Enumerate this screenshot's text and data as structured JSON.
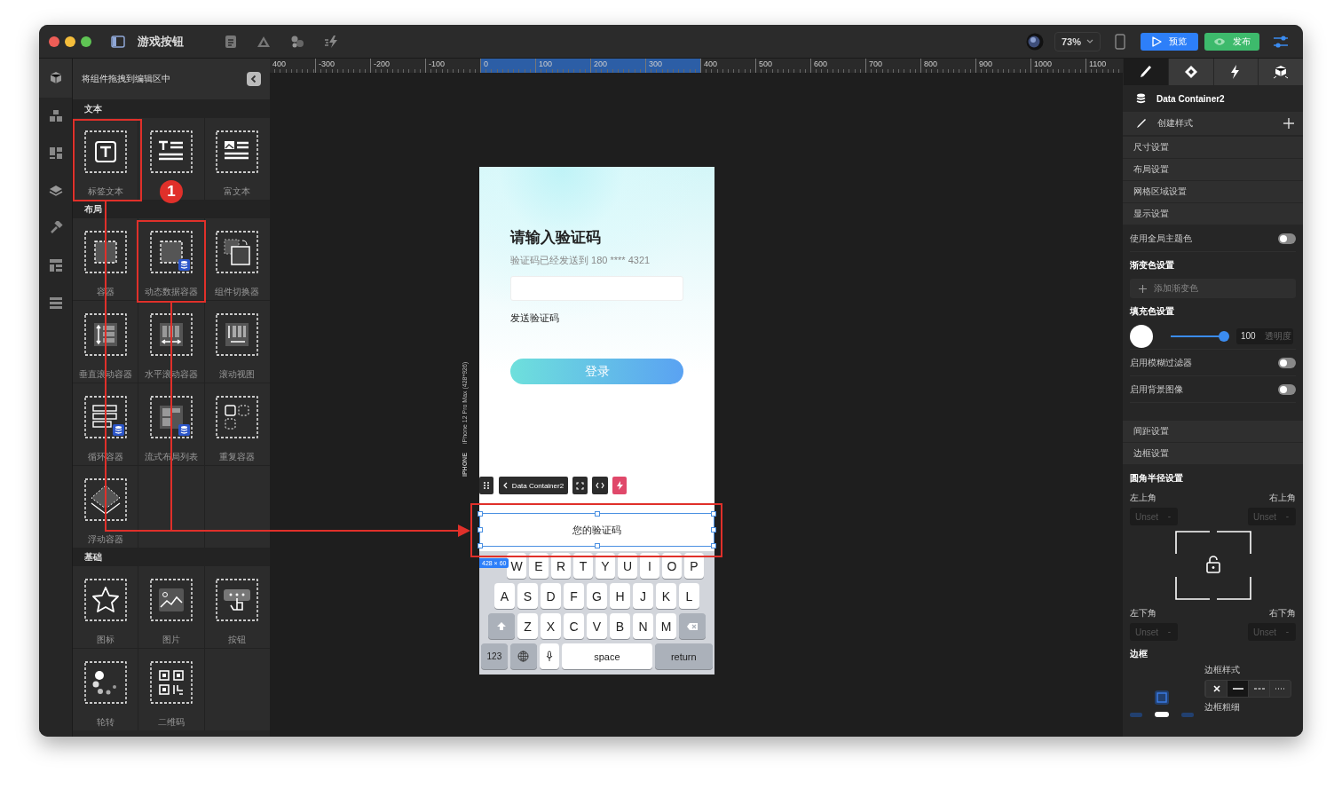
{
  "window": {
    "title": "游戏按钮"
  },
  "toolbar": {
    "zoom": "73%",
    "preview_button": "预览",
    "publish_button": "发布"
  },
  "rail": [
    {
      "selected": true
    },
    {
      "selected": false
    },
    {
      "selected": false
    },
    {
      "selected": false
    },
    {
      "selected": false
    },
    {
      "selected": false
    },
    {
      "selected": false
    }
  ],
  "ruler": {
    "marks": [
      {
        "label": "400",
        "highlighted": false
      },
      {
        "label": "-300",
        "highlighted": false
      },
      {
        "label": "-200",
        "highlighted": false
      },
      {
        "label": "-100",
        "highlighted": false
      },
      {
        "label": "0",
        "highlighted": true
      },
      {
        "label": "100",
        "highlighted": true
      },
      {
        "label": "200",
        "highlighted": true
      },
      {
        "label": "300",
        "highlighted": true
      },
      {
        "label": "400",
        "highlighted": false
      },
      {
        "label": "500",
        "highlighted": false
      },
      {
        "label": "600",
        "highlighted": false
      },
      {
        "label": "700",
        "highlighted": false
      },
      {
        "label": "800",
        "highlighted": false
      },
      {
        "label": "900",
        "highlighted": false
      },
      {
        "label": "1000",
        "highlighted": false
      },
      {
        "label": "1100",
        "highlighted": false
      }
    ]
  },
  "component_panel": {
    "header": "将组件拖拽到编辑区中",
    "sections": [
      {
        "title": "文本",
        "items": [
          {
            "kind": "tile",
            "label": "标签文本"
          },
          {
            "kind": "tile"
          },
          {
            "kind": "tile",
            "label": "富文本"
          }
        ]
      },
      {
        "title": "布局",
        "items": [
          {
            "kind": "tile",
            "label": "容器"
          },
          {
            "kind": "tile",
            "label": "动态数据容器"
          },
          {
            "kind": "tile",
            "label": "组件切换器"
          },
          {
            "kind": "tile",
            "label": "垂直滚动容器"
          },
          {
            "kind": "tile",
            "label": "水平滚动容器"
          },
          {
            "kind": "tile",
            "label": "滚动视图"
          },
          {
            "kind": "tile",
            "label": "循环容器"
          },
          {
            "kind": "tile",
            "label": "流式布局列表"
          },
          {
            "kind": "tile",
            "label": "重复容器"
          },
          {
            "kind": "tile",
            "label": "浮动容器"
          }
        ]
      },
      {
        "title": "基础",
        "items": [
          {
            "kind": "tile",
            "label": "图标"
          },
          {
            "kind": "tile",
            "label": "图片"
          },
          {
            "kind": "tile",
            "label": "按钮"
          },
          {
            "kind": "tile",
            "label": "轮转"
          },
          {
            "kind": "tile",
            "label": "二维码"
          }
        ]
      }
    ]
  },
  "phone": {
    "device_type": "IPHONE",
    "device_label": "iPhone 12 Pro Max (428*926)",
    "title": "请输入验证码",
    "subtitle": "验证码已经发送到 180 **** 4321",
    "send_code_link": "发送验证码",
    "login_button": "登录",
    "element_toolbar": {
      "breadcrumb": "Data Container2"
    },
    "selected_element": {
      "text": "您的验证码",
      "size": "428 × 60"
    },
    "keyboard": {
      "rows": [
        [
          "W",
          "E",
          "R",
          "T",
          "Y",
          "U",
          "I",
          "O",
          "P"
        ],
        [
          "A",
          "S",
          "D",
          "F",
          "G",
          "H",
          "J",
          "K",
          "L"
        ],
        [
          "Z",
          "X",
          "C",
          "V",
          "B",
          "N",
          "M"
        ]
      ],
      "numbers_key": "123",
      "space_key": "space",
      "return_key": "return"
    }
  },
  "annotations": {
    "step_badge": "1"
  },
  "inspector": {
    "tabs": [
      {
        "selected": true
      },
      {
        "selected": false
      },
      {
        "selected": false
      },
      {
        "selected": false
      }
    ],
    "component_name": "Data Container2",
    "create_style": "创建样式",
    "groups": [
      "尺寸设置",
      "布局设置",
      "网格区域设置",
      "显示设置"
    ],
    "theme_toggle": {
      "label": "使用全局主题色",
      "on": false
    },
    "gradient": {
      "title": "渐变色设置",
      "add_button": "添加渐变色"
    },
    "fill": {
      "title": "填充色设置",
      "color": "#ffffff",
      "level": 1,
      "opacity": "100",
      "opacity_unit": "透明度"
    },
    "toggles": [
      {
        "label": "启用模糊过滤器",
        "on": false
      },
      {
        "label": "启用背景图像",
        "on": false
      }
    ],
    "groups2": [
      "间距设置",
      "边框设置"
    ],
    "radius": {
      "title": "圆角半径设置",
      "corners": [
        {
          "label": "左上角",
          "placeholder": "Unset",
          "unit": "-"
        },
        {
          "label": "右上角",
          "placeholder": "Unset",
          "unit": "-"
        },
        {
          "label": "左下角",
          "placeholder": "Unset",
          "unit": "-"
        },
        {
          "label": "右下角",
          "placeholder": "Unset",
          "unit": "-"
        }
      ]
    },
    "border": {
      "title": "边框",
      "style_label": "边框样式",
      "styles": [
        {
          "kind": "none",
          "selected": false
        },
        {
          "kind": "solid",
          "selected": true
        },
        {
          "kind": "dashed",
          "selected": false
        },
        {
          "kind": "dotted",
          "selected": false
        }
      ],
      "width_label": "边框粗细"
    }
  }
}
